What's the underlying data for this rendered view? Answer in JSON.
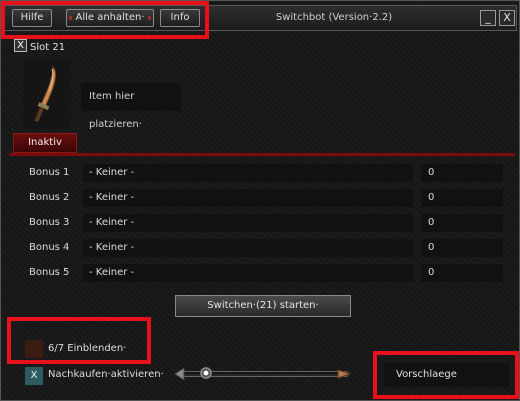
{
  "window": {
    "title": "Switchbot (Version·2.2)",
    "minimize_glyph": "_",
    "close_glyph": "X"
  },
  "toolbar": {
    "help_label": "Hilfe",
    "stop_all_label": "Alle anhalten·",
    "info_label": "Info"
  },
  "slot": {
    "close_glyph": "X",
    "label": "Slot 21",
    "item_icon": "sword-icon",
    "placeholder": "Item hier platzieren·",
    "status": "Inaktiv"
  },
  "bonuses": [
    {
      "label": "Bonus 1",
      "value": "- Keiner -",
      "amount": "0"
    },
    {
      "label": "Bonus 2",
      "value": "- Keiner -",
      "amount": "0"
    },
    {
      "label": "Bonus 3",
      "value": "- Keiner -",
      "amount": "0"
    },
    {
      "label": "Bonus 4",
      "value": "- Keiner -",
      "amount": "0"
    },
    {
      "label": "Bonus 5",
      "value": "- Keiner -",
      "amount": "0"
    }
  ],
  "start_button": "Switchen·(21) starten·",
  "show_toggle": {
    "label": "6/7 Einblenden·",
    "checked": false
  },
  "rebuy": {
    "label": "Nachkaufen·aktivieren·",
    "glyph": "X",
    "checked": true
  },
  "speed_slider": {
    "level": 0.1
  },
  "suggestions_label": "Vorschlaege",
  "colors": {
    "accent_red": "#7a0c0c",
    "highlight": "#e8101a",
    "checkbox_active": "#2e5a62"
  }
}
